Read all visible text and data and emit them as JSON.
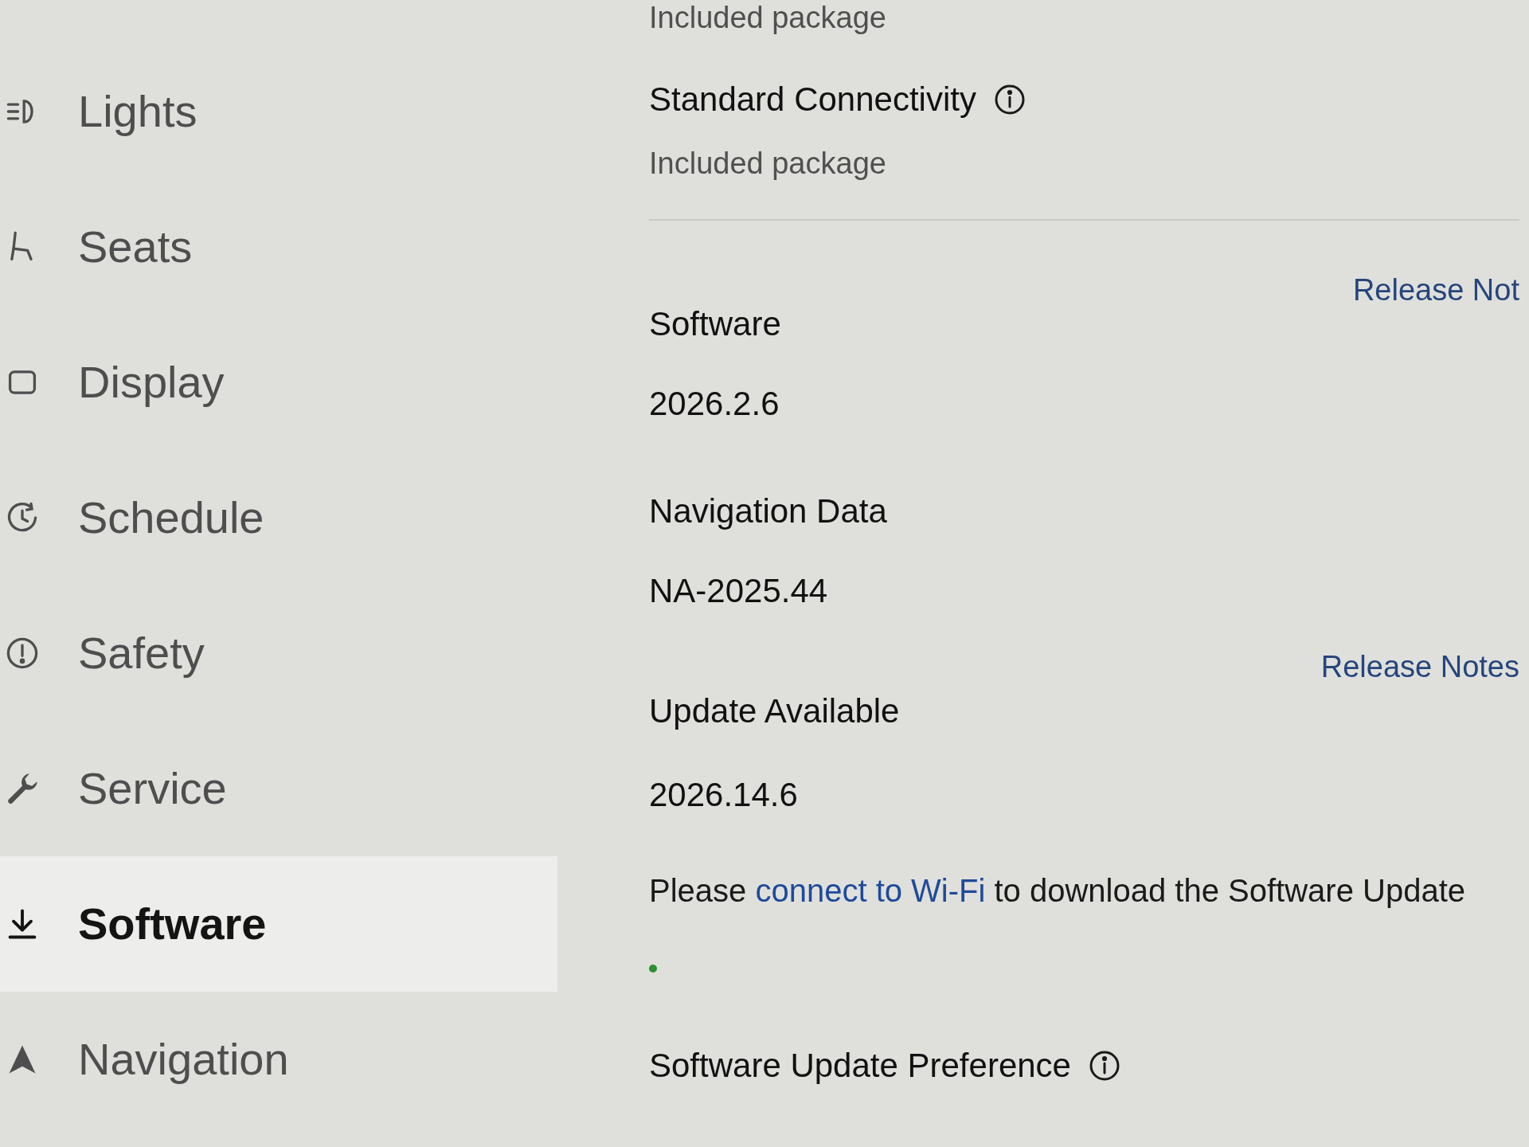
{
  "sidebar": {
    "items": [
      {
        "label": "Lights",
        "kind": "lights",
        "selected": false
      },
      {
        "label": "Seats",
        "kind": "seats",
        "selected": false
      },
      {
        "label": "Display",
        "kind": "display",
        "selected": false
      },
      {
        "label": "Schedule",
        "kind": "schedule",
        "selected": false
      },
      {
        "label": "Safety",
        "kind": "safety",
        "selected": false
      },
      {
        "label": "Service",
        "kind": "service",
        "selected": false
      },
      {
        "label": "Software",
        "kind": "software",
        "selected": true
      },
      {
        "label": "Navigation",
        "kind": "navigation",
        "selected": false
      }
    ]
  },
  "content": {
    "cut_subtitle": "Included package",
    "connectivity": {
      "title": "Standard Connectivity",
      "info": true,
      "subtitle": "Included package"
    },
    "software": {
      "link": "Release Not",
      "title": "Software",
      "version": "2026.2.6"
    },
    "navigation_data": {
      "title": "Navigation Data",
      "version": "NA-2025.44"
    },
    "update": {
      "link": "Release Notes",
      "title": "Update Available",
      "version": "2026.14.6",
      "message": [
        {
          "kind": "text",
          "text": "Please "
        },
        {
          "kind": "link",
          "text": "connect to Wi-Fi"
        },
        {
          "kind": "text",
          "text": " to download the Software Update"
        }
      ]
    },
    "preference": {
      "title": "Software Update Preference",
      "info": true
    }
  }
}
